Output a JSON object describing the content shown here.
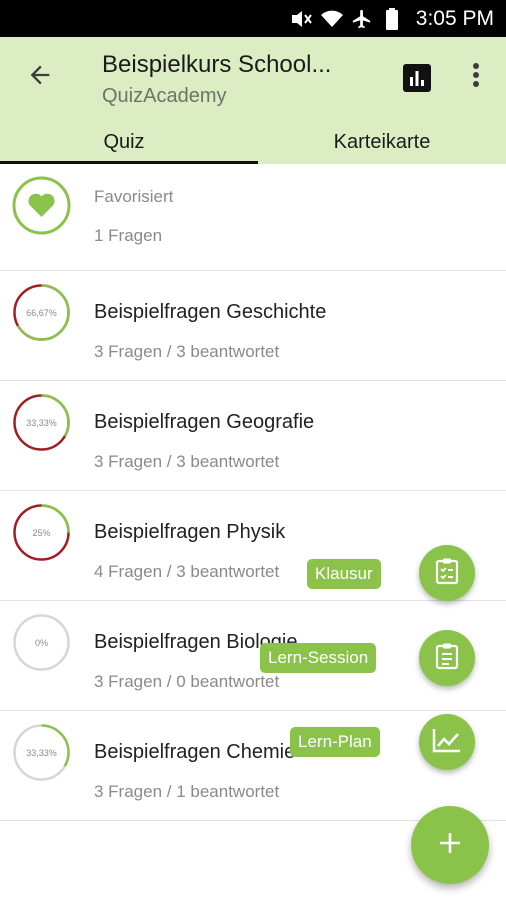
{
  "status_bar": {
    "time": "3:05 PM",
    "icons": [
      "mute-icon",
      "wifi-icon",
      "airplane-icon",
      "battery-icon"
    ]
  },
  "app_bar": {
    "title": "Beispielkurs School...",
    "subtitle": "QuizAcademy",
    "icons": {
      "back": "arrow-back-icon",
      "stats": "bar-chart-icon",
      "more": "more-vert-icon"
    }
  },
  "tabs": [
    {
      "label": "Quiz",
      "active": true
    },
    {
      "label": "Karteikarte",
      "active": false
    }
  ],
  "favorite": {
    "label": "Favorisiert",
    "count": "1 Fragen",
    "icon": "heart-icon"
  },
  "quizzes": [
    {
      "title": "Beispielfragen Geschichte",
      "meta": "3 Fragen / 3 beantwortet",
      "percent_label": "66,67%",
      "progress": 0.6667,
      "ring_color": "#a11f24"
    },
    {
      "title": "Beispielfragen Geografie",
      "meta": "3 Fragen / 3 beantwortet",
      "percent_label": "33,33%",
      "progress": 0.3333,
      "ring_color": "#a11f24"
    },
    {
      "title": "Beispielfragen Physik",
      "meta": "4 Fragen / 3 beantwortet",
      "percent_label": "25%",
      "progress": 0.25,
      "ring_color": "#a11f24"
    },
    {
      "title": "Beispielfragen Biologie",
      "meta": "3 Fragen / 0 beantwortet",
      "percent_label": "0%",
      "progress": 0.0,
      "ring_color": "#d6d6d6"
    },
    {
      "title": "Beispielfragen Chemie",
      "meta": "3 Fragen / 1 beantwortet",
      "percent_label": "33,33%",
      "progress": 0.3333,
      "ring_color": "#d6d6d6"
    }
  ],
  "fab_menu": [
    {
      "label": "Klausur",
      "icon": "clipboard-checklist-icon"
    },
    {
      "label": "Lern-Session",
      "icon": "clipboard-list-icon"
    },
    {
      "label": "Lern-Plan",
      "icon": "trending-chart-icon"
    }
  ],
  "main_fab": {
    "icon": "plus-icon"
  },
  "colors": {
    "accent": "#8bc34a",
    "app_bar": "#dcedc3",
    "wrong": "#a11f24",
    "unanswered": "#d6d6d6"
  }
}
